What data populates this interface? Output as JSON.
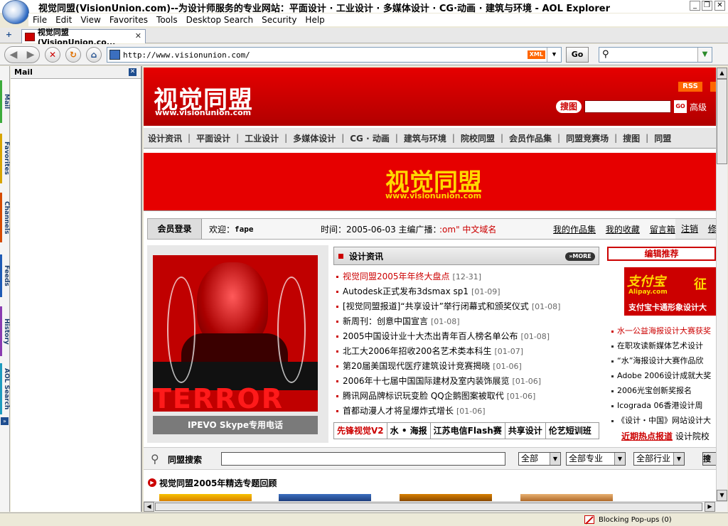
{
  "window": {
    "title": "视觉同盟(VisionUnion.com)--为设计师服务的专业网站：平面设计 · 工业设计 · 多媒体设计 · CG·动画 · 建筑与环境 - AOL Explorer",
    "minimize": "_",
    "restore": "❐",
    "close": "✕"
  },
  "menu": [
    "File",
    "Edit",
    "View",
    "Favorites",
    "Tools",
    "Desktop Search",
    "Security",
    "Help"
  ],
  "tab": {
    "label": "视觉同盟(VisionUnion.co...",
    "new_tab": "+",
    "close": "✕"
  },
  "address": {
    "url": "http://www.visionunion.com/",
    "xml": "XML",
    "go": "Go",
    "search_placeholder": ""
  },
  "vtabs": [
    {
      "label": "Mail",
      "color": "#3cab3c"
    },
    {
      "label": "Favorites",
      "color": "#d8a400"
    },
    {
      "label": "Channels",
      "color": "#d64b00"
    },
    {
      "label": "Feeds",
      "color": "#1e5bb5"
    },
    {
      "label": "History",
      "color": "#8a3bb0"
    },
    {
      "label": "AOL Search",
      "color": "#1e9cbf"
    }
  ],
  "sidebar": {
    "title": "Mail",
    "close": "✕"
  },
  "site": {
    "logo": "视觉同盟",
    "logo_url": "www.visionunion.com",
    "rss": "RSS",
    "search_btn": "搜图",
    "search_go": "GO",
    "advanced": "高级",
    "nav": [
      "设计资讯",
      "平面设计",
      "工业设计",
      "多媒体设计",
      "CG · 动画",
      "建筑与环境",
      "院校同盟",
      "会员作品集",
      "同盟竞赛场",
      "搜图",
      "同盟"
    ],
    "banner_logo": "视觉同盟",
    "banner_url": "www.visionunion.com"
  },
  "info": {
    "login": "会员登录",
    "welcome": "欢迎：",
    "user": "fape",
    "time": "时间：2005-06-03 主编广播：",
    "broadcast": ":om\" 中文域名",
    "links": [
      "我的作品集",
      "我的收藏",
      "留言箱"
    ],
    "logout": [
      "注销",
      "修改"
    ]
  },
  "promo": {
    "art_text": "TERROR",
    "caption": "IPEVO Skype专用电话"
  },
  "news": {
    "title": "设计资讯",
    "more": "»MORE",
    "items": [
      {
        "title": "视觉同盟2005年年终大盘点",
        "date": "[12-31]"
      },
      {
        "title": "Autodesk正式发布3dsmax sp1",
        "date": "[01-09]"
      },
      {
        "title": "[视觉同盟报道]“共享设计”举行闭幕式和颁奖仪式",
        "date": "[01-08]"
      },
      {
        "title": "新周刊：创意中国宣言",
        "date": "[01-08]"
      },
      {
        "title": "2005中国设计业十大杰出青年百人榜名单公布",
        "date": "[01-08]"
      },
      {
        "title": "北工大2006年招收200名艺术类本科生",
        "date": "[01-07]"
      },
      {
        "title": "第20届美国现代医疗建筑设计竞赛揭晓",
        "date": "[01-06]"
      },
      {
        "title": "2006年十七届中国国际建材及室内装饰展览",
        "date": "[01-06]"
      },
      {
        "title": "腾讯网品牌标识玩变脸 QQ企鹅图案被取代",
        "date": "[01-06]"
      },
      {
        "title": "首都动漫人才将呈爆炸式增长",
        "date": "[01-06]"
      }
    ],
    "tabs": [
      "先锋视觉V2",
      "水 • 海报",
      "江苏电信Flash赛",
      "共享设计",
      "伦艺短训班"
    ]
  },
  "editor": {
    "title": "编辑推荐",
    "ad_brand": "支付宝",
    "ad_sub": "Alipay.com",
    "ad_zheng": "征",
    "ad_text": "支付宝卡通形象设计大",
    "items": [
      "水一公益海报设计大赛获奖",
      "在职攻读新媒体艺术设计",
      "“水”海报设计大赛作品欣",
      "Adobe 2006设计成就大奖",
      "2006光宝创新奖报名",
      "Icograda 06香港设计周",
      "《设计・中国》网站设计大"
    ],
    "hot_label": "近期热点报道",
    "hot_text": "设计院校"
  },
  "union_search": {
    "label": "同盟搜索",
    "sel1": "全部",
    "sel2": "全部专业",
    "sel3": "全部行业",
    "btn": "搜"
  },
  "special": {
    "title": "视觉同盟2005年精选专题回顾"
  },
  "status": {
    "popups": "Blocking Pop-ups (0)"
  }
}
